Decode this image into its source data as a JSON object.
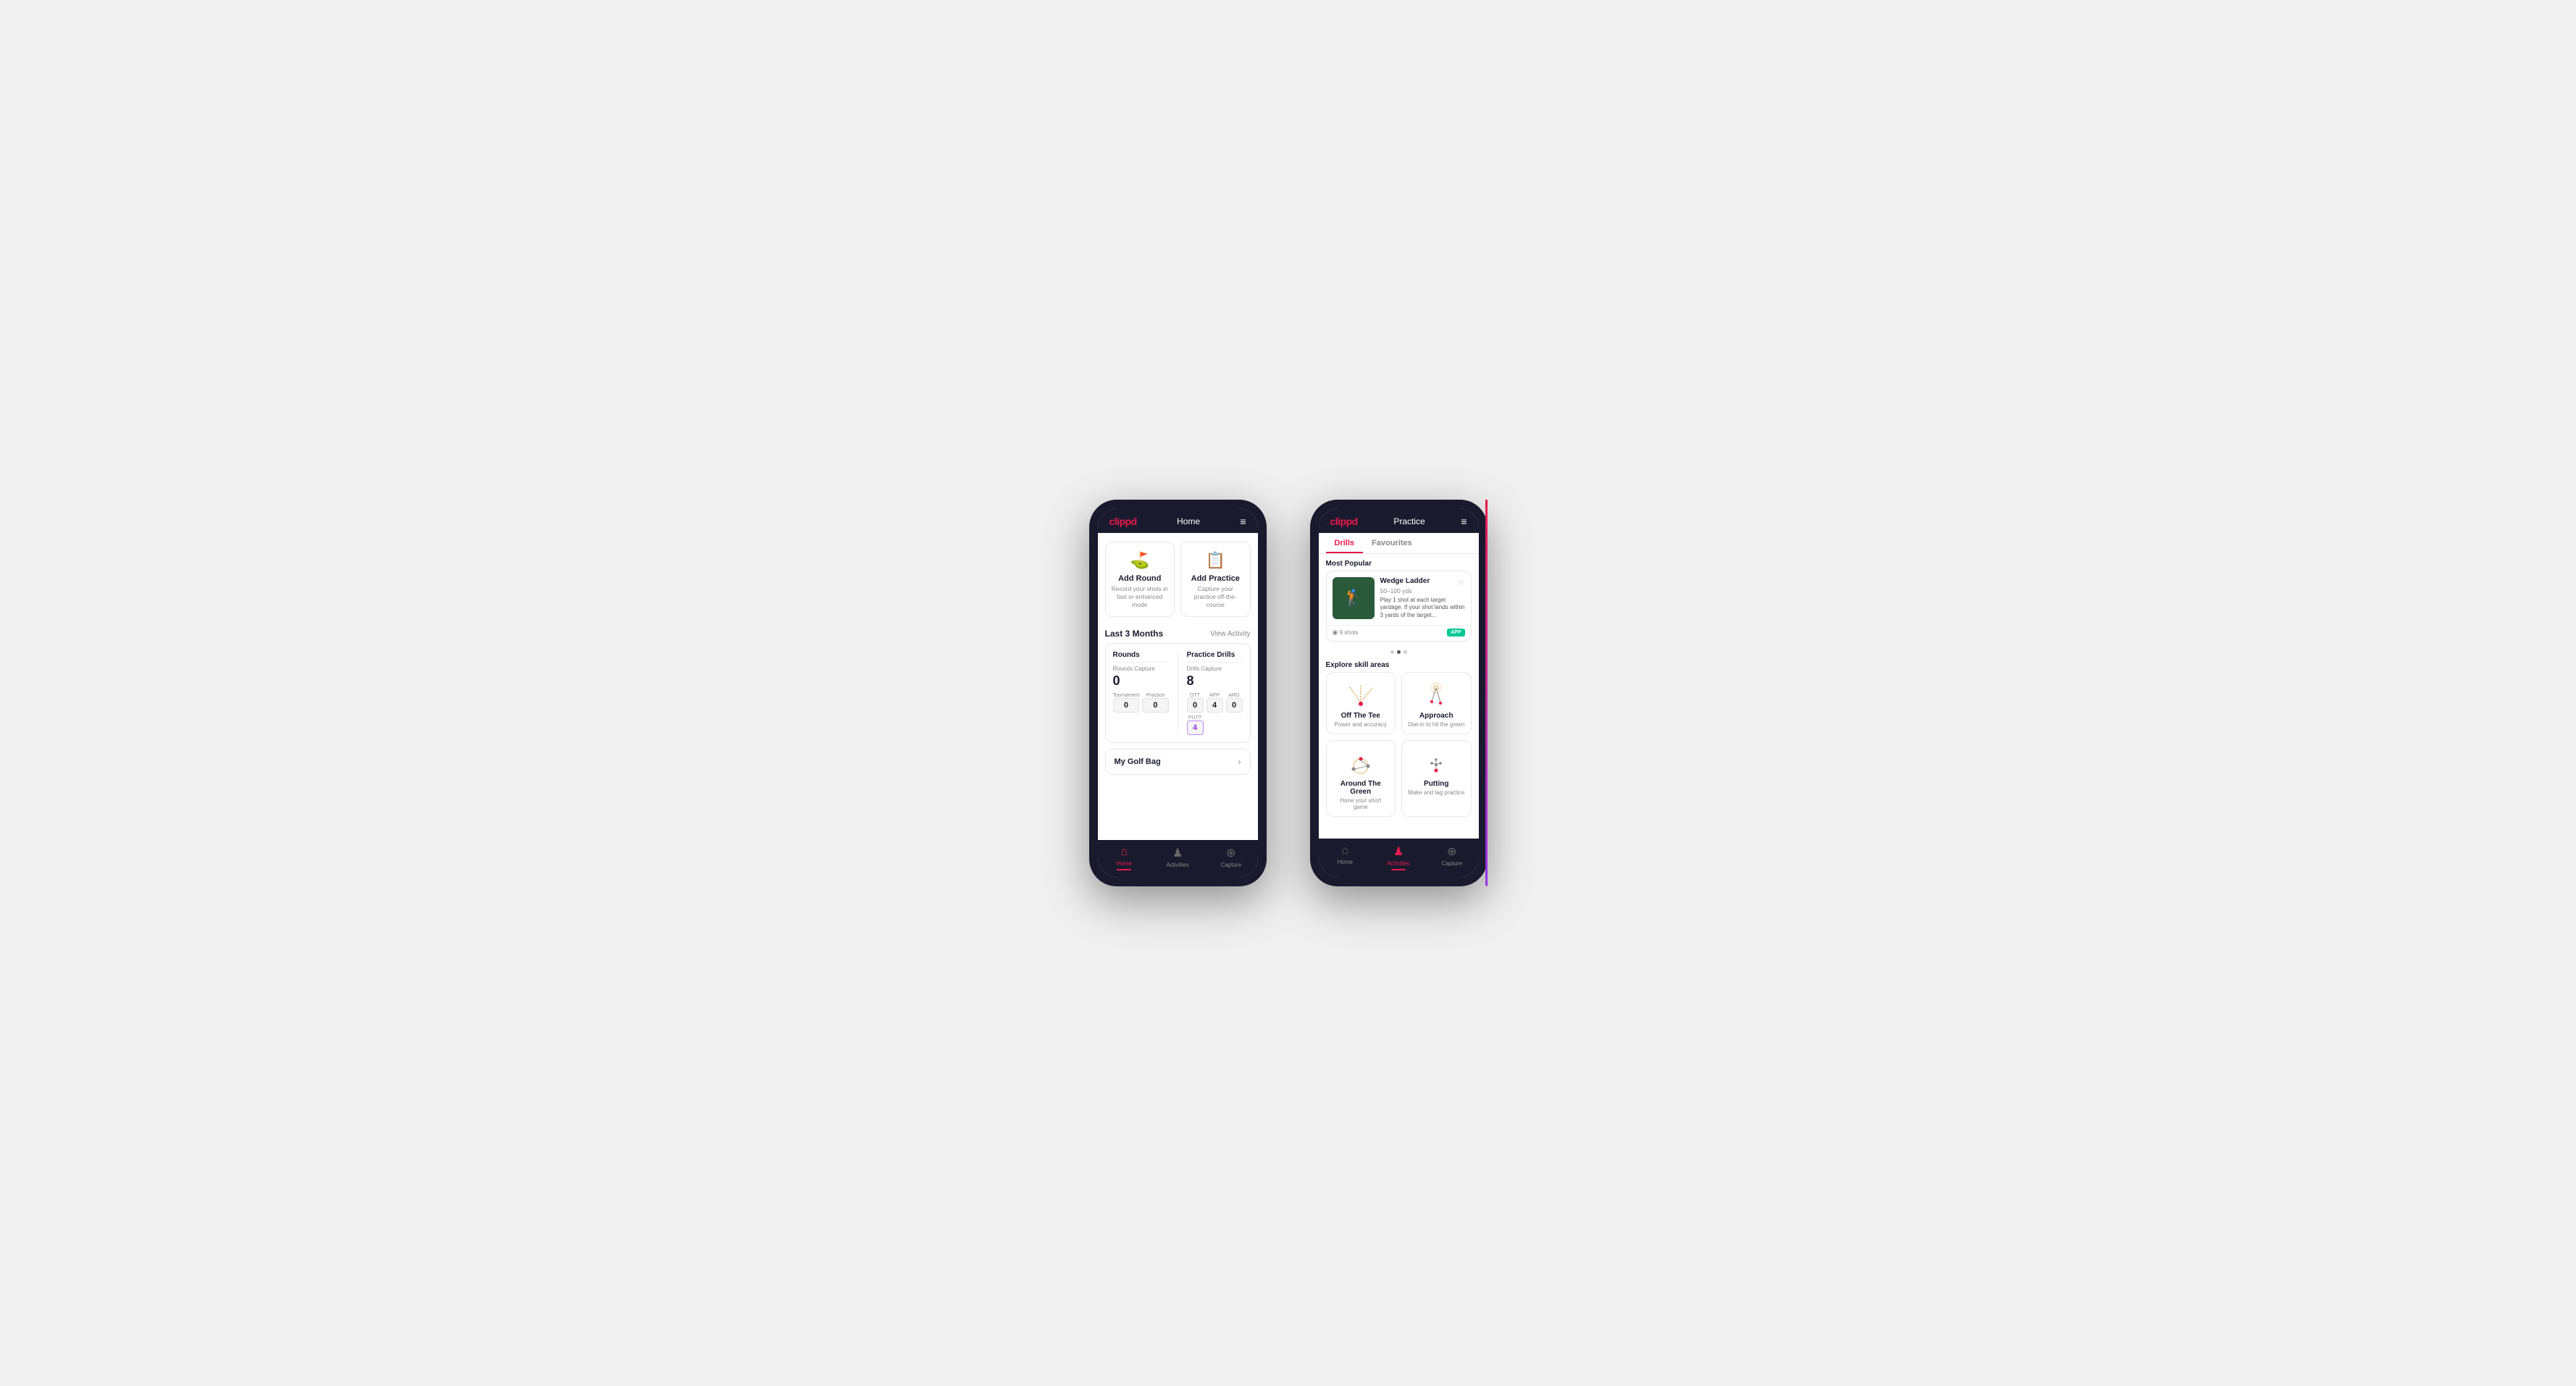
{
  "phone1": {
    "logo": "clippd",
    "title": "Home",
    "cards": [
      {
        "id": "add-round",
        "title": "Add Round",
        "sub": "Record your shots in fast or enhanced mode",
        "icon": "⛳"
      },
      {
        "id": "add-practice",
        "title": "Add Practice",
        "sub": "Capture your practice off-the-course",
        "icon": "📋"
      }
    ],
    "activity": {
      "section_title": "Last 3 Months",
      "view_link": "View Activity"
    },
    "rounds": {
      "title": "Rounds",
      "capture_label": "Rounds Capture",
      "total": "0",
      "tournament_label": "Tournament",
      "tournament_value": "0",
      "practice_label": "Practice",
      "practice_value": "0"
    },
    "drills": {
      "title": "Practice Drills",
      "capture_label": "Drills Capture",
      "total": "8",
      "ott_label": "OTT",
      "ott_value": "0",
      "app_label": "APP",
      "app_value": "4",
      "arg_label": "ARG",
      "arg_value": "0",
      "putt_label": "PUTT",
      "putt_value": "4"
    },
    "golf_bag": {
      "label": "My Golf Bag"
    },
    "nav": [
      {
        "id": "home",
        "label": "Home",
        "icon": "🏠",
        "active": true
      },
      {
        "id": "activities",
        "label": "Activities",
        "icon": "⛳",
        "active": false
      },
      {
        "id": "capture",
        "label": "Capture",
        "icon": "➕",
        "active": false
      }
    ]
  },
  "phone2": {
    "logo": "clippd",
    "title": "Practice",
    "tabs": [
      {
        "id": "drills",
        "label": "Drills",
        "active": true
      },
      {
        "id": "favourites",
        "label": "Favourites",
        "active": false
      }
    ],
    "most_popular": "Most Popular",
    "drill": {
      "name": "Wedge Ladder",
      "yardage": "50–100 yds",
      "description": "Play 1 shot at each target yardage. If your shot lands within 3 yards of the target...",
      "shots": "9 shots",
      "badge": "APP"
    },
    "dots": [
      1,
      2,
      3
    ],
    "explore_label": "Explore skill areas",
    "skills": [
      {
        "id": "off-tee",
        "name": "Off The Tee",
        "sub": "Power and accuracy",
        "icon": "tee"
      },
      {
        "id": "approach",
        "name": "Approach",
        "sub": "Dial-in to hit the green",
        "icon": "approach"
      },
      {
        "id": "around-green",
        "name": "Around The Green",
        "sub": "Hone your short game",
        "icon": "around-green"
      },
      {
        "id": "putting",
        "name": "Putting",
        "sub": "Make and lag practice",
        "icon": "putting"
      }
    ],
    "nav": [
      {
        "id": "home",
        "label": "Home",
        "icon": "🏠",
        "active": false
      },
      {
        "id": "activities",
        "label": "Activities",
        "icon": "⛳",
        "active": true
      },
      {
        "id": "capture",
        "label": "Capture",
        "icon": "➕",
        "active": false
      }
    ]
  }
}
